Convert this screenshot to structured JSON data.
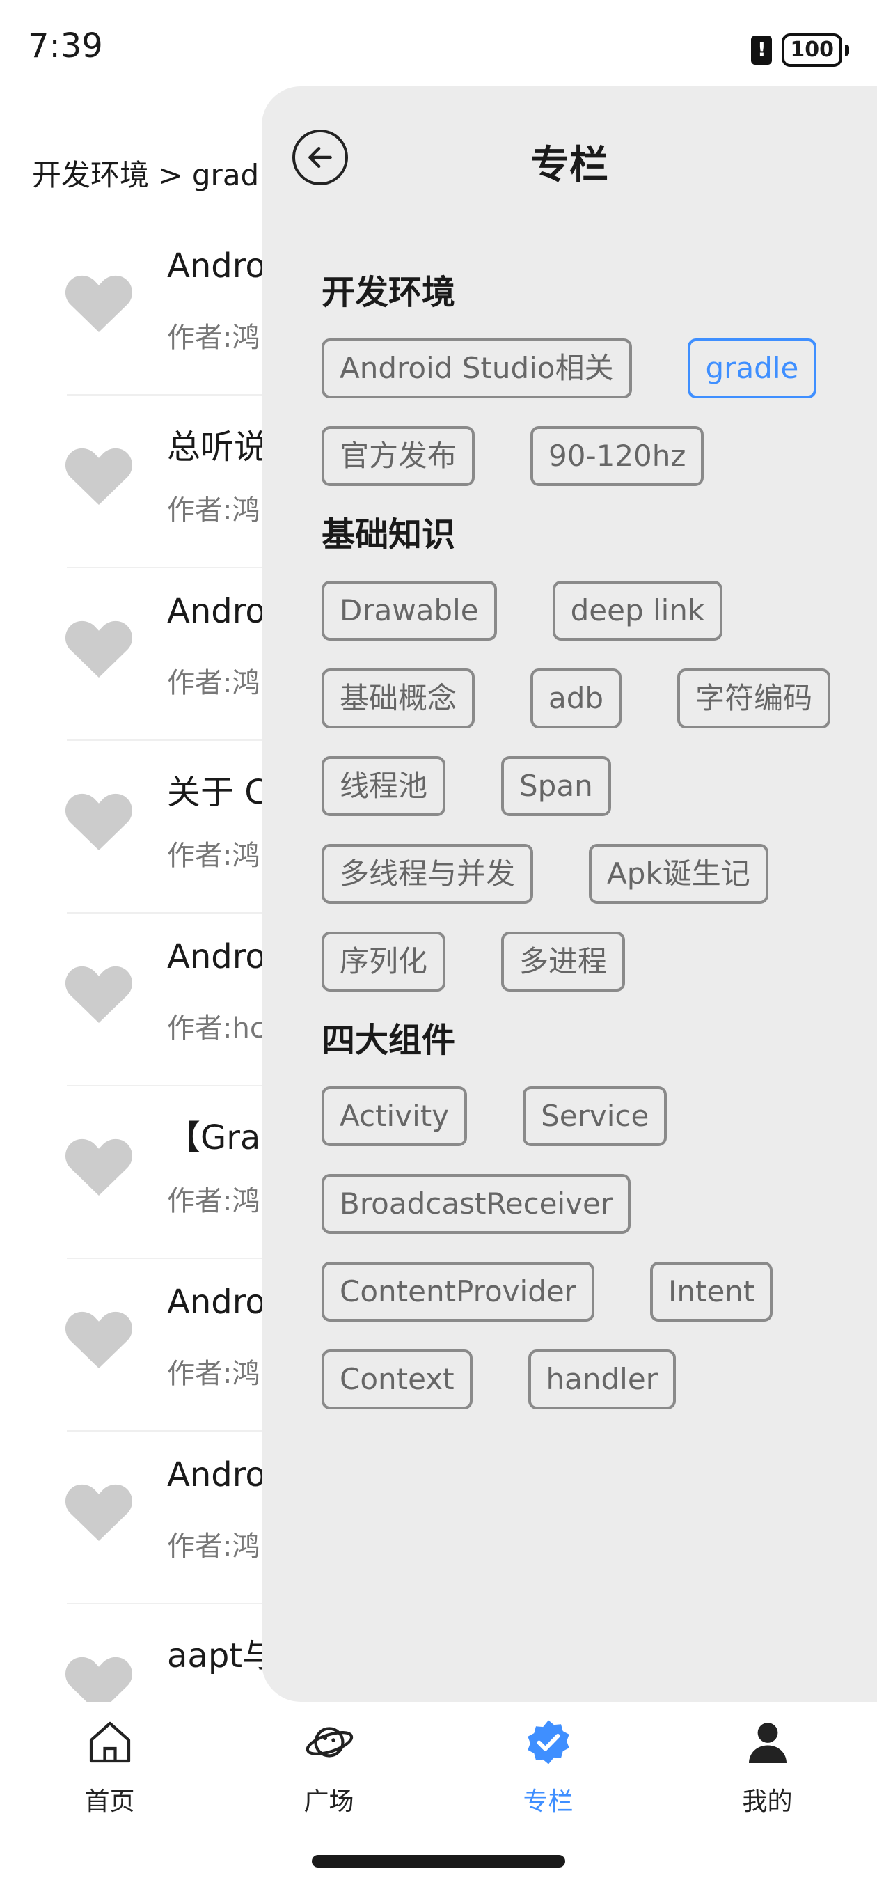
{
  "status_bar": {
    "time": "7:39",
    "battery": "100"
  },
  "breadcrumb": "开发环境 > gradle",
  "articles": [
    {
      "title": "Andro",
      "author": "作者:鸿"
    },
    {
      "title": "总听说",
      "author": "作者:鸿"
    },
    {
      "title": "Andro",
      "author": "作者:鸿"
    },
    {
      "title": "关于 C",
      "author": "作者:鸿"
    },
    {
      "title": "Andro",
      "author": "作者:hc"
    },
    {
      "title": "【Gra",
      "author": "作者:鸿"
    },
    {
      "title": "Andro",
      "author": "作者:鸿"
    },
    {
      "title": "Andro",
      "author": "作者:鸿"
    },
    {
      "title": "aapt与",
      "author": ""
    }
  ],
  "drawer": {
    "title": "专栏",
    "sections": [
      {
        "title": "开发环境",
        "chips": [
          "Android Studio相关",
          "gradle",
          "官方发布",
          "90-120hz"
        ]
      },
      {
        "title": "基础知识",
        "chips": [
          "Drawable",
          "deep link",
          "基础概念",
          "adb",
          "字符编码",
          "线程池",
          "Span",
          "多线程与并发",
          "Apk诞生记",
          "序列化",
          "多进程"
        ]
      },
      {
        "title": "四大组件",
        "chips": [
          "Activity",
          "Service",
          "BroadcastReceiver",
          "ContentProvider",
          "Intent",
          "Context",
          "handler"
        ]
      }
    ],
    "selected_chip": "gradle"
  },
  "bottom_nav": [
    {
      "label": "首页",
      "icon": "home-icon"
    },
    {
      "label": "广场",
      "icon": "planet-icon"
    },
    {
      "label": "专栏",
      "icon": "verified-badge-icon",
      "active": true
    },
    {
      "label": "我的",
      "icon": "person-icon"
    }
  ],
  "colors": {
    "accent": "#3f8fff",
    "drawer_bg": "#ececec",
    "chip_border": "#8a8a8a",
    "heart": "#cccccc"
  }
}
